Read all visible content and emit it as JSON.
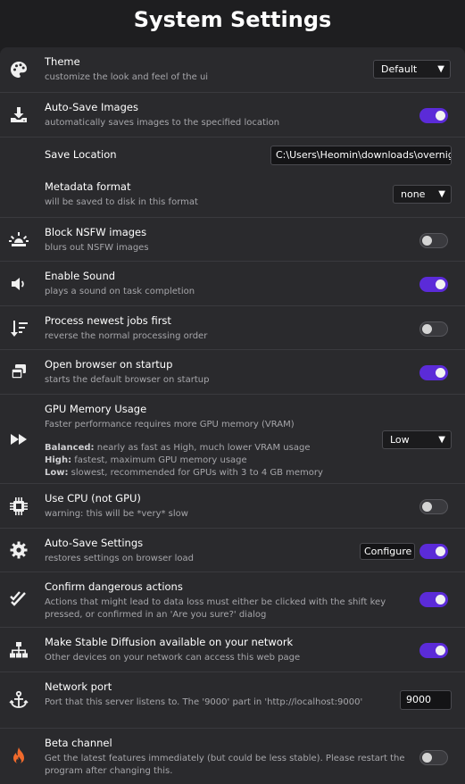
{
  "page": {
    "title": "System Settings"
  },
  "settings": {
    "theme": {
      "label": "Theme",
      "desc": "customize the look and feel of the ui",
      "value": "Default",
      "icon": "palette-icon"
    },
    "autosave_images": {
      "label": "Auto-Save Images",
      "desc": "automatically saves images to the specified location",
      "enabled": true,
      "icon": "download-icon"
    },
    "save_location": {
      "label": "Save Location",
      "value": "C:\\Users\\Heomin\\downloads\\overnight"
    },
    "metadata_format": {
      "label": "Metadata format",
      "desc": "will be saved to disk in this format",
      "value": "none"
    },
    "block_nsfw": {
      "label": "Block NSFW images",
      "desc": "blurs out NSFW images",
      "enabled": false,
      "icon": "siren-icon"
    },
    "enable_sound": {
      "label": "Enable Sound",
      "desc": "plays a sound on task completion",
      "enabled": true,
      "icon": "volume-icon"
    },
    "process_newest": {
      "label": "Process newest jobs first",
      "desc": "reverse the normal processing order",
      "enabled": false,
      "icon": "sort-descending-icon"
    },
    "open_browser": {
      "label": "Open browser on startup",
      "desc": "starts the default browser on startup",
      "enabled": true,
      "icon": "window-restore-icon"
    },
    "gpu_memory": {
      "label": "GPU Memory Usage",
      "desc": "Faster performance requires more GPU memory (VRAM)",
      "balanced_label": "Balanced:",
      "balanced_text": " nearly as fast as High, much lower VRAM usage",
      "high_label": "High:",
      "high_text": " fastest, maximum GPU memory usage",
      "low_label": "Low:",
      "low_text": " slowest, recommended for GPUs with 3 to 4 GB memory",
      "value": "Low",
      "icon": "fast-forward-icon"
    },
    "use_cpu": {
      "label": "Use CPU (not GPU)",
      "desc": "warning: this will be *very* slow",
      "enabled": false,
      "icon": "microchip-icon"
    },
    "autosave_settings": {
      "label": "Auto-Save Settings",
      "desc": "restores settings on browser load",
      "button": "Configure",
      "enabled": true,
      "icon": "gear-icon"
    },
    "confirm_dangerous": {
      "label": "Confirm dangerous actions",
      "desc": "Actions that might lead to data loss must either be clicked with the shift key pressed, or confirmed in an 'Are you sure?' dialog",
      "enabled": true,
      "icon": "check-double-icon"
    },
    "network_available": {
      "label": "Make Stable Diffusion available on your network",
      "desc": "Other devices on your network can access this web page",
      "enabled": true,
      "icon": "network-icon"
    },
    "network_port": {
      "label": "Network port",
      "desc": "Port that this server listens to. The '9000' part in 'http://localhost:9000'",
      "value": "9000",
      "icon": "anchor-icon"
    },
    "beta_channel": {
      "label": "Beta channel",
      "desc": "Get the latest features immediately (but could be less stable). Please restart the program after changing this.",
      "enabled": false,
      "icon": "fire-icon"
    }
  },
  "colors": {
    "accent": "#5b2bd8",
    "background": "#1e1e20",
    "panel": "#2a2a2d",
    "fire": "#f06a2c"
  }
}
